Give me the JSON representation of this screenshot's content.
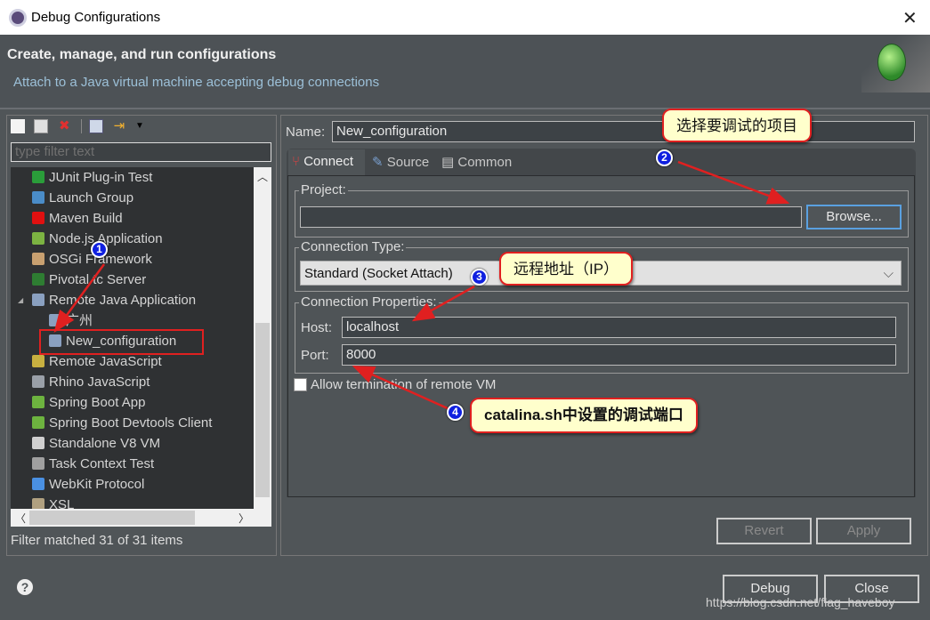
{
  "window": {
    "title": "Debug Configurations",
    "close_icon": "close-icon"
  },
  "header": {
    "title": "Create, manage, and run configurations",
    "subtitle": "Attach to a Java virtual machine accepting debug connections"
  },
  "left": {
    "filter_placeholder": "type filter text",
    "tree": [
      {
        "label": "JUnit Plug-in Test",
        "icon": "junit-icon",
        "color": "#2a9d3a"
      },
      {
        "label": "Launch Group",
        "icon": "launch-group-icon",
        "color": "#4a8cc8"
      },
      {
        "label": "Maven Build",
        "icon": "maven-icon",
        "color": "#e01010"
      },
      {
        "label": "Node.js Application",
        "icon": "nodejs-icon",
        "color": "#7cb342"
      },
      {
        "label": "OSGi Framework",
        "icon": "osgi-icon",
        "color": "#c8a070"
      },
      {
        "label": "Pivotal tc Server",
        "icon": "pivotal-icon",
        "color": "#2e7d32"
      },
      {
        "label": "Remote Java Application",
        "icon": "remote-java-icon",
        "color": "#8aa0c0",
        "expanded": true
      },
      {
        "label": "广州",
        "icon": "remote-java-icon",
        "color": "#8aa0c0",
        "child": true
      },
      {
        "label": "New_configuration",
        "icon": "remote-java-icon",
        "color": "#8aa0c0",
        "child": true,
        "selected": true
      },
      {
        "label": "Remote JavaScript",
        "icon": "remote-js-icon",
        "color": "#c8b040"
      },
      {
        "label": "Rhino JavaScript",
        "icon": "rhino-icon",
        "color": "#9aa0a8"
      },
      {
        "label": "Spring Boot App",
        "icon": "spring-boot-icon",
        "color": "#6db33f"
      },
      {
        "label": "Spring Boot Devtools Client",
        "icon": "spring-devtools-icon",
        "color": "#6db33f"
      },
      {
        "label": "Standalone V8 VM",
        "icon": "v8-icon",
        "color": "#d0d0d0"
      },
      {
        "label": "Task Context Test",
        "icon": "task-test-icon",
        "color": "#a0a0a0"
      },
      {
        "label": "WebKit Protocol",
        "icon": "webkit-icon",
        "color": "#4a90e2"
      },
      {
        "label": "XSL",
        "icon": "xsl-icon",
        "color": "#b0a080"
      }
    ],
    "filter_status": "Filter matched 31 of 31 items"
  },
  "form": {
    "name_label": "Name:",
    "name_value": "New_configuration",
    "tabs": [
      {
        "label": "Connect",
        "active": true
      },
      {
        "label": "Source"
      },
      {
        "label": "Common"
      }
    ],
    "project_label": "Project:",
    "project_value": "",
    "browse_label": "Browse...",
    "conn_type_label": "Connection Type:",
    "conn_type_value": "Standard (Socket Attach)",
    "conn_props_label": "Connection Properties:",
    "host_label": "Host:",
    "host_value": "localhost",
    "port_label": "Port:",
    "port_value": "8000",
    "allow_term_label": "Allow termination of remote VM",
    "allow_term_checked": false,
    "revert_label": "Revert",
    "apply_label": "Apply"
  },
  "footer": {
    "debug_label": "Debug",
    "close_label": "Close",
    "help": "?"
  },
  "annotations": {
    "c1": "1",
    "c2": "2",
    "c3": "3",
    "c4": "4",
    "callout2": "选择要调试的项目",
    "callout3": "远程地址（IP）",
    "callout4": "catalina.sh中设置的调试端口",
    "accent": "#e02020"
  },
  "watermark": "https://blog.csdn.net/flag_haveboy"
}
